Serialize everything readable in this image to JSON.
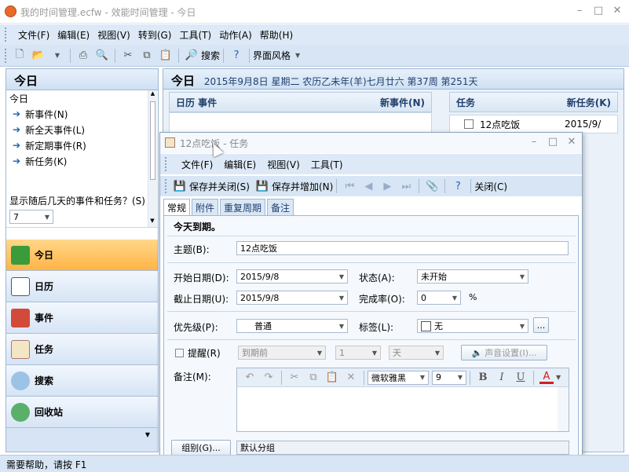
{
  "window": {
    "title": "我的时间管理.ecfw - 效能时间管理 - 今日"
  },
  "menu": [
    "文件(F)",
    "编辑(E)",
    "视图(V)",
    "转到(G)",
    "工具(T)",
    "动作(A)",
    "帮助(H)"
  ],
  "toolbar": {
    "search_label": "搜索",
    "theme_label": "界面风格"
  },
  "left": {
    "title": "今日",
    "list_title": "今日",
    "items": [
      "新事件(N)",
      "新全天事件(L)",
      "新定期事件(R)",
      "新任务(K)"
    ],
    "days_label": "显示随后几天的事件和任务？(S)",
    "days_value": "7",
    "nav": [
      "今日",
      "日历",
      "事件",
      "任务",
      "搜索",
      "回收站"
    ]
  },
  "today": {
    "title": "今日",
    "date": "2015年9月8日 星期二 农历乙未年(羊)七月廿六 第37周 第251天",
    "cal_header": "日历 事件",
    "new_event": "新事件(N)",
    "task_header": "任务",
    "new_task": "新任务(K)",
    "task_name": "12点吃饭",
    "task_date": "2015/9/"
  },
  "dialog": {
    "title": "12点吃饭 - 任务",
    "menu": [
      "文件(F)",
      "编辑(E)",
      "视图(V)",
      "工具(T)"
    ],
    "save_close": "保存并关闭(S)",
    "save_add": "保存并增加(N)",
    "close": "关闭(C)",
    "tabs": [
      "常规",
      "附件",
      "重复周期",
      "备注"
    ],
    "due_note": "今天到期。",
    "subject_label": "主题(B):",
    "subject": "12点吃饭",
    "start_label": "开始日期(D):",
    "start": "2015/9/8",
    "status_label": "状态(A):",
    "status": "未开始",
    "due_label": "截止日期(U):",
    "due": "2015/9/8",
    "complete_label": "完成率(O):",
    "complete": "0",
    "percent": "%",
    "priority_label": "优先级(P):",
    "priority": "普通",
    "tag_label": "标签(L):",
    "tag": "无",
    "more": "...",
    "remind_label": "提醒(R)",
    "remind_when": "到期前",
    "remind_num": "1",
    "remind_unit": "天",
    "sound_label": "声音设置(I)...",
    "notes_label": "备注(M):",
    "font": "微软雅黑",
    "font_size": "9",
    "group_btn": "组别(G)...",
    "group_value": "默认分组"
  },
  "status": "需要帮助，请按 F1"
}
